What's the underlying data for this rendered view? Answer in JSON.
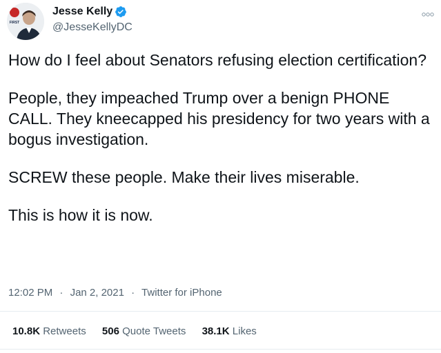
{
  "user": {
    "display_name": "Jesse Kelly",
    "handle": "@JesseKellyDC",
    "verified": true,
    "avatar_badge_text": "FIRST"
  },
  "tweet": {
    "paragraphs": [
      "How do I feel about Senators refusing election certification?",
      "People, they impeached Trump over a benign PHONE CALL. They kneecapped his presidency for two years with a bogus investigation.",
      "SCREW these people. Make their lives miserable.",
      "This is how it is now."
    ],
    "time": "12:02 PM",
    "date": "Jan 2, 2021",
    "source": "Twitter for iPhone",
    "separator": "·"
  },
  "stats": {
    "retweets_count": "10.8K",
    "retweets_label": "Retweets",
    "quotes_count": "506",
    "quotes_label": "Quote Tweets",
    "likes_count": "38.1K",
    "likes_label": "Likes"
  },
  "colors": {
    "text": "#0f1419",
    "muted": "#536471",
    "verified": "#1d9bf0",
    "divider": "#e6ecf0"
  },
  "icons": [
    "verified-badge-icon",
    "more-options-icon"
  ]
}
